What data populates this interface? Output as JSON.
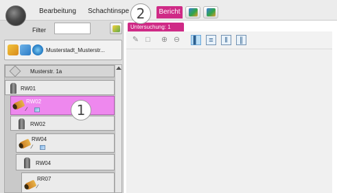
{
  "menu": {
    "bearbeitung": "Bearbeitung",
    "schachtinspektion": "Schachtinspe",
    "bericht": "Bericht"
  },
  "filter": {
    "label": "Filter",
    "value": ""
  },
  "project": {
    "label": "Musterstadt_Musterstr..."
  },
  "tree": {
    "street": "Musterstr. 1a",
    "items": [
      {
        "label": "RW01",
        "type": "shaft"
      },
      {
        "label": "RW02",
        "type": "pipe",
        "selected": true
      },
      {
        "label": "RW02",
        "type": "shaft"
      },
      {
        "label": "RW04",
        "type": "pipe"
      },
      {
        "label": "RW04",
        "type": "shaft"
      },
      {
        "label": "RR07",
        "type": "pipe"
      }
    ]
  },
  "document_tab": {
    "label": "Untersuchung: 1"
  },
  "callouts": {
    "one": "1",
    "two": "2"
  },
  "colors": {
    "accent": "#cf2a86",
    "selection": "#ee88ee"
  }
}
